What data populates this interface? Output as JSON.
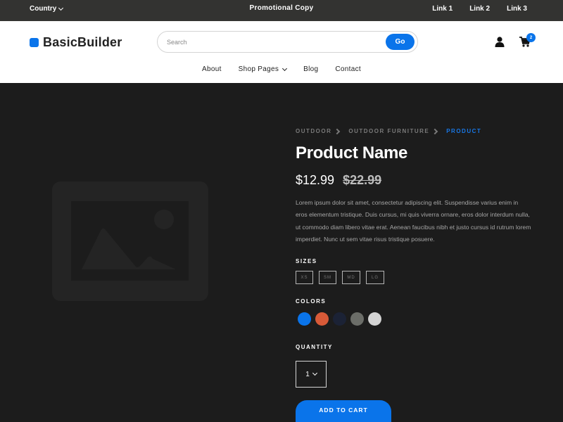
{
  "topbar": {
    "country_label": "Country",
    "promo": "Promotional Copy",
    "links": [
      "Link 1",
      "Link 2",
      "Link 3"
    ]
  },
  "header": {
    "brand": "BasicBuilder",
    "brand_color": "#0a74ea",
    "search": {
      "placeholder": "Search",
      "value": "",
      "button_label": "Go"
    },
    "user_icon": "user-icon",
    "cart_icon": "cart-icon",
    "cart_count": "2"
  },
  "nav": {
    "items": [
      {
        "label": "About",
        "has_dropdown": false
      },
      {
        "label": "Shop Pages",
        "has_dropdown": true
      },
      {
        "label": "Blog",
        "has_dropdown": false
      },
      {
        "label": "Contact",
        "has_dropdown": false
      }
    ]
  },
  "product": {
    "image_icon": "image-placeholder-icon",
    "breadcrumb": [
      "OUTDOOR",
      "OUTDOOR FURNITURE",
      "PRODUCT"
    ],
    "name": "Product Name",
    "price": "$12.99",
    "old_price": "$22.99",
    "description": "Lorem ipsum dolor sit amet, consectetur adipiscing elit. Suspendisse varius enim in eros elementum tristique. Duis cursus, mi quis viverra ornare, eros dolor interdum nulla, ut commodo diam libero vitae erat. Aenean faucibus nibh et justo cursus id rutrum lorem imperdiet. Nunc ut sem vitae risus tristique posuere.",
    "sizes_label": "SIZES",
    "sizes": [
      "XS",
      "SM",
      "MD",
      "LG"
    ],
    "colors_label": "COLORS",
    "colors": [
      "#0a74ea",
      "#d85a38",
      "#1b2235",
      "#6b6d68",
      "#d4d4d4"
    ],
    "quantity_label": "QUANTITY",
    "quantity": "1",
    "add_to_cart": "ADD TO CART"
  }
}
